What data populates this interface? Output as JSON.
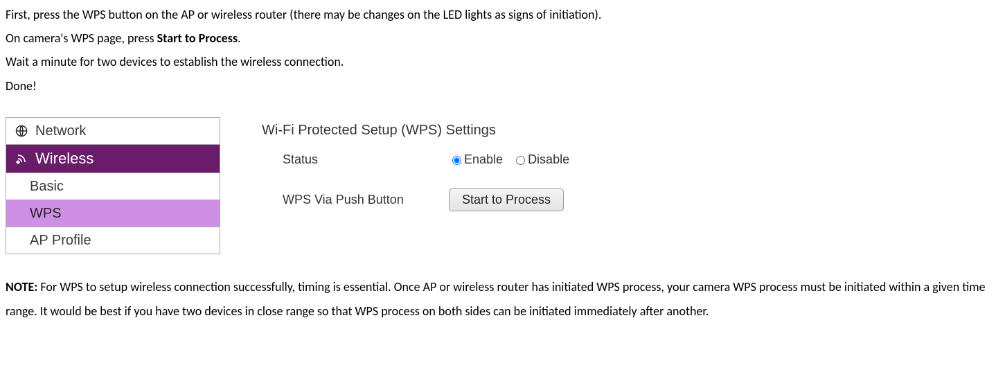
{
  "instructions": {
    "line1_a": "First, press the WPS button on the AP or wireless router (there may be changes on the LED lights as signs of initiation).",
    "line2_a": "On camera's WPS page, press ",
    "line2_bold": "Start to Process",
    "line2_b": ".",
    "line3": "Wait a minute for two devices to establish the wireless connection.",
    "line4": "Done!"
  },
  "nav": {
    "network": "Network",
    "wireless": "Wireless",
    "basic": "Basic",
    "wps": "WPS",
    "ap_profile": "AP Profile"
  },
  "settings": {
    "title": "Wi-Fi Protected Setup (WPS) Settings",
    "status_label": "Status",
    "enable": "Enable",
    "disable": "Disable",
    "push_label": "WPS Via Push Button",
    "button": "Start to Process"
  },
  "note": {
    "prefix": "NOTE:",
    "body": " For WPS to setup wireless connection successfully, timing is essential. Once AP or wireless router has initiated WPS process, your camera WPS process must be initiated within a given time range. It would be best if you have two devices in close range so that WPS process on both sides can be initiated immediately after another."
  }
}
